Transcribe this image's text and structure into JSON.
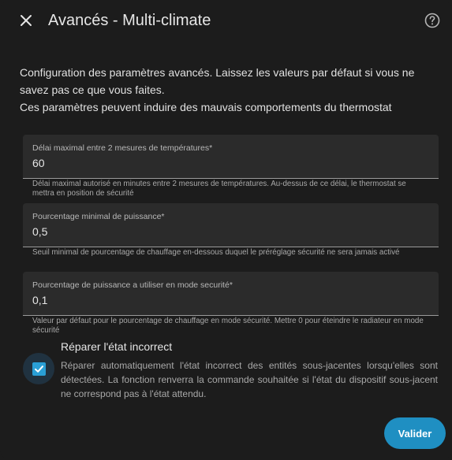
{
  "dialog": {
    "title": "Avancés - Multi-climate",
    "close_icon": "close-icon",
    "help_icon": "help-circle-icon"
  },
  "intro": {
    "line1": "Configuration des paramètres avancés. Laissez les valeurs par défaut si vous ne savez pas ce que vous faites.",
    "line2": "Ces paramètres peuvent induire des mauvais comportements du thermostat"
  },
  "fields": [
    {
      "label": "Délai maximal entre 2 mesures de températures*",
      "value": "60",
      "helper": "Délai maximal autorisé en minutes entre 2 mesures de températures. Au-dessus de ce délai, le thermostat se mettra en position de sécurité"
    },
    {
      "label": "Pourcentage minimal de puissance*",
      "value": "0,5",
      "helper": "Seuil minimal de pourcentage de chauffage en-dessous duquel le préréglage sécurité ne sera jamais activé"
    },
    {
      "label": "Pourcentage de puissance a utiliser en mode securité*",
      "value": "0,1",
      "helper": "Valeur par défaut pour le pourcentage de chauffage en mode sécurité. Mettre 0 pour éteindre le radiateur en mode sécurité"
    }
  ],
  "repair": {
    "title": "Réparer l'état incorrect",
    "description": "Réparer automatiquement l'état incorrect des entités sous-jacentes lorsqu'elles sont détectées. La fonction renverra la commande souhaitée si l'état du dispositif sous-jacent ne correspond pas à l'état attendu.",
    "checked": true,
    "check_icon": "checkmark-icon"
  },
  "actions": {
    "submit_label": "Valider"
  },
  "colors": {
    "background": "#1c1c1c",
    "field_background": "#2b2b2b",
    "accent": "#1f8fc2",
    "checkbox": "#2a9fd6"
  }
}
